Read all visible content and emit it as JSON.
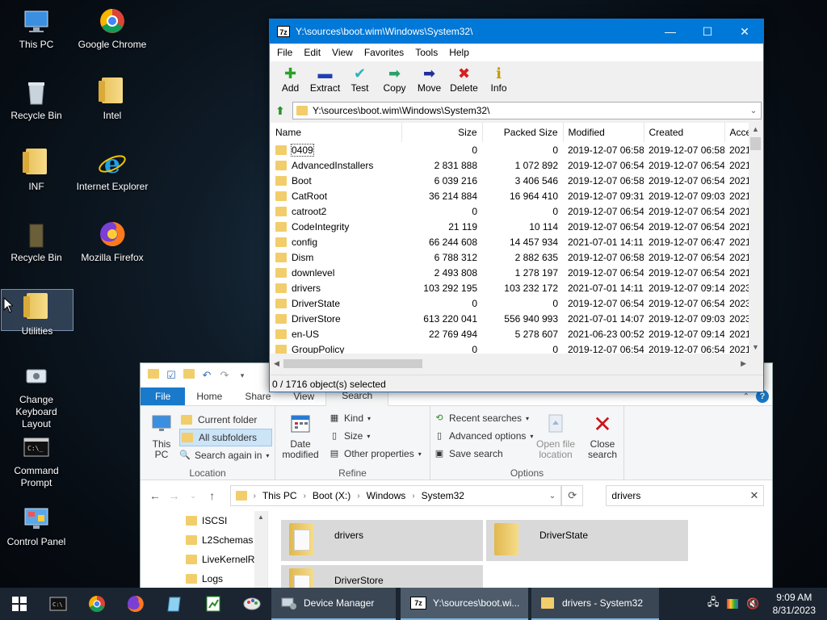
{
  "desktop": {
    "icons": [
      {
        "label": "This PC",
        "icon": "monitor-icon"
      },
      {
        "label": "Google Chrome",
        "icon": "chrome-icon"
      },
      {
        "label": "Recycle Bin",
        "icon": "recycle-bin-icon"
      },
      {
        "label": "Intel",
        "icon": "folder-icon"
      },
      {
        "label": "INF",
        "icon": "folder-icon"
      },
      {
        "label": "Internet Explorer",
        "icon": "internet-explorer-icon"
      },
      {
        "label": "Recycle Bin",
        "icon": "recycle-bin-icon"
      },
      {
        "label": "Mozilla Firefox",
        "icon": "firefox-icon"
      },
      {
        "label": "Utilities",
        "icon": "folder-icon"
      },
      {
        "label": "Change Keyboard Layout",
        "icon": "keyboard-icon"
      },
      {
        "label": "Command Prompt",
        "icon": "command-prompt-icon"
      },
      {
        "label": "Control Panel",
        "icon": "control-panel-icon"
      }
    ]
  },
  "sevenzip": {
    "title": "Y:\\sources\\boot.wim\\Windows\\System32\\",
    "app_icon_text": "7z",
    "menu": [
      "File",
      "Edit",
      "View",
      "Favorites",
      "Tools",
      "Help"
    ],
    "toolbar": [
      {
        "label": "Add",
        "icon": "plus-icon",
        "glyph": "✚",
        "color": "#2aa12a"
      },
      {
        "label": "Extract",
        "icon": "minus-icon",
        "glyph": "▬",
        "color": "#1f3fb5"
      },
      {
        "label": "Test",
        "icon": "check-icon",
        "glyph": "✔",
        "color": "#2bb5b5"
      },
      {
        "label": "Copy",
        "icon": "arrow-right-icon",
        "glyph": "➡",
        "color": "#2aa16a"
      },
      {
        "label": "Move",
        "icon": "arrow-right-icon",
        "glyph": "➡",
        "color": "#1f2f9c"
      },
      {
        "label": "Delete",
        "icon": "delete-x-icon",
        "glyph": "✖",
        "color": "#d81e1e"
      },
      {
        "label": "Info",
        "icon": "info-icon",
        "glyph": "ℹ",
        "color": "#c79a00"
      }
    ],
    "address": "Y:\\sources\\boot.wim\\Windows\\System32\\",
    "columns": [
      "Name",
      "Size",
      "Packed Size",
      "Modified",
      "Created",
      "Acce"
    ],
    "rows": [
      {
        "name": "0409",
        "size": "0",
        "packed": "0",
        "modified": "2019-12-07 06:58",
        "created": "2019-12-07 06:58",
        "accessed": "2021-"
      },
      {
        "name": "AdvancedInstallers",
        "size": "2 831 888",
        "packed": "1 072 892",
        "modified": "2019-12-07 06:54",
        "created": "2019-12-07 06:54",
        "accessed": "2021-"
      },
      {
        "name": "Boot",
        "size": "6 039 216",
        "packed": "3 406 546",
        "modified": "2019-12-07 06:58",
        "created": "2019-12-07 06:54",
        "accessed": "2021-"
      },
      {
        "name": "CatRoot",
        "size": "36 214 884",
        "packed": "16 964 410",
        "modified": "2019-12-07 09:31",
        "created": "2019-12-07 09:03",
        "accessed": "2021-"
      },
      {
        "name": "catroot2",
        "size": "0",
        "packed": "0",
        "modified": "2019-12-07 06:54",
        "created": "2019-12-07 06:54",
        "accessed": "2021-"
      },
      {
        "name": "CodeIntegrity",
        "size": "21 119",
        "packed": "10 114",
        "modified": "2019-12-07 06:54",
        "created": "2019-12-07 06:54",
        "accessed": "2021-"
      },
      {
        "name": "config",
        "size": "66 244 608",
        "packed": "14 457 934",
        "modified": "2021-07-01 14:11",
        "created": "2019-12-07 06:47",
        "accessed": "2021-"
      },
      {
        "name": "Dism",
        "size": "6 788 312",
        "packed": "2 882 635",
        "modified": "2019-12-07 06:58",
        "created": "2019-12-07 06:54",
        "accessed": "2021-"
      },
      {
        "name": "downlevel",
        "size": "2 493 808",
        "packed": "1 278 197",
        "modified": "2019-12-07 06:54",
        "created": "2019-12-07 06:54",
        "accessed": "2021-"
      },
      {
        "name": "drivers",
        "size": "103 292 195",
        "packed": "103 232 172",
        "modified": "2021-07-01 14:11",
        "created": "2019-12-07 09:14",
        "accessed": "2023-"
      },
      {
        "name": "DriverState",
        "size": "0",
        "packed": "0",
        "modified": "2019-12-07 06:54",
        "created": "2019-12-07 06:54",
        "accessed": "2023-"
      },
      {
        "name": "DriverStore",
        "size": "613 220 041",
        "packed": "556 940 993",
        "modified": "2021-07-01 14:07",
        "created": "2019-12-07 09:03",
        "accessed": "2023-"
      },
      {
        "name": "en-US",
        "size": "22 769 494",
        "packed": "5 278 607",
        "modified": "2021-06-23 00:52",
        "created": "2019-12-07 09:14",
        "accessed": "2021-"
      },
      {
        "name": "GroupPolicy",
        "size": "0",
        "packed": "0",
        "modified": "2019-12-07 06:54",
        "created": "2019-12-07 06:54",
        "accessed": "2021-"
      }
    ],
    "status": "0 / 1716 object(s) selected"
  },
  "explorer": {
    "tabs": [
      "File",
      "Home",
      "Share",
      "View",
      "Search"
    ],
    "ribbon": {
      "location": {
        "label": "Location",
        "this_pc": "This PC",
        "current_folder": "Current folder",
        "all_subfolders": "All subfolders",
        "search_again_in": "Search again in"
      },
      "refine": {
        "label": "Refine",
        "date_modified": "Date modified",
        "kind": "Kind",
        "size": "Size",
        "other_properties": "Other properties"
      },
      "options": {
        "label": "Options",
        "recent_searches": "Recent searches",
        "advanced_options": "Advanced options",
        "save_search": "Save search",
        "open_file_location": "Open file location",
        "close_search": "Close search"
      }
    },
    "breadcrumb": [
      "This PC",
      "Boot (X:)",
      "Windows",
      "System32"
    ],
    "search_value": "drivers",
    "nav_items": [
      "ISCSI",
      "L2Schemas",
      "LiveKernelR",
      "Logs"
    ],
    "results": [
      "drivers",
      "DriverState",
      "DriverStore"
    ]
  },
  "taskbar": {
    "tasks": [
      {
        "label": "Device Manager",
        "state": "open"
      },
      {
        "label": "Y:\\sources\\boot.wi...",
        "state": "active"
      },
      {
        "label": "drivers - System32",
        "state": "open"
      }
    ],
    "time": "9:09 AM",
    "date": "8/31/2023"
  }
}
